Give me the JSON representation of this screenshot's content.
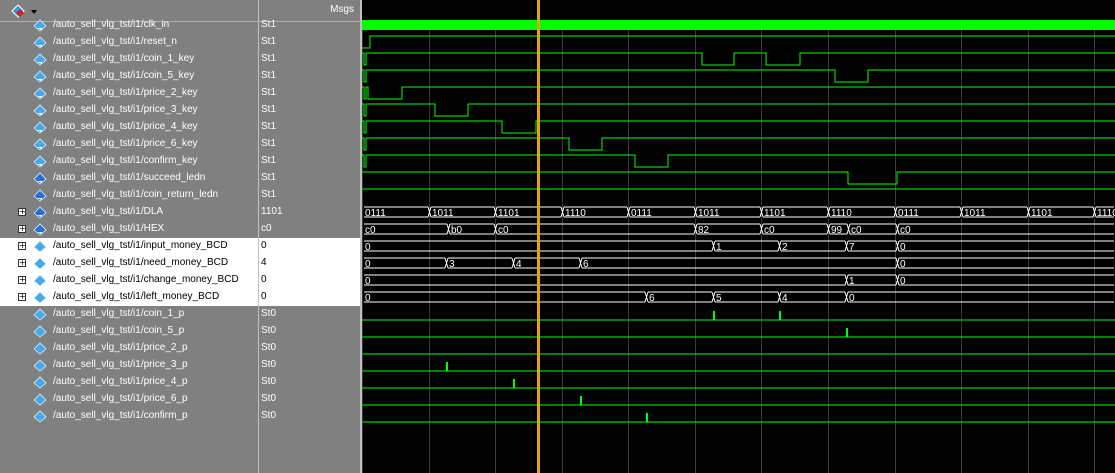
{
  "header": {
    "msgs_label": "Msgs"
  },
  "signals": [
    {
      "name": "/auto_sell_vlg_tst/i1/clk_in",
      "value": "St1",
      "kind": "in",
      "bus": false
    },
    {
      "name": "/auto_sell_vlg_tst/i1/reset_n",
      "value": "St1",
      "kind": "in",
      "bus": false
    },
    {
      "name": "/auto_sell_vlg_tst/i1/coin_1_key",
      "value": "St1",
      "kind": "in",
      "bus": false
    },
    {
      "name": "/auto_sell_vlg_tst/i1/coin_5_key",
      "value": "St1",
      "kind": "in",
      "bus": false
    },
    {
      "name": "/auto_sell_vlg_tst/i1/price_2_key",
      "value": "St1",
      "kind": "in",
      "bus": false
    },
    {
      "name": "/auto_sell_vlg_tst/i1/price_3_key",
      "value": "St1",
      "kind": "in",
      "bus": false
    },
    {
      "name": "/auto_sell_vlg_tst/i1/price_4_key",
      "value": "St1",
      "kind": "in",
      "bus": false
    },
    {
      "name": "/auto_sell_vlg_tst/i1/price_6_key",
      "value": "St1",
      "kind": "in",
      "bus": false
    },
    {
      "name": "/auto_sell_vlg_tst/i1/confirm_key",
      "value": "St1",
      "kind": "in",
      "bus": false
    },
    {
      "name": "/auto_sell_vlg_tst/i1/succeed_ledn",
      "value": "St1",
      "kind": "out",
      "bus": false
    },
    {
      "name": "/auto_sell_vlg_tst/i1/coin_return_ledn",
      "value": "St1",
      "kind": "out",
      "bus": false
    },
    {
      "name": "/auto_sell_vlg_tst/i1/DLA",
      "value": "1101",
      "kind": "out",
      "bus": true
    },
    {
      "name": "/auto_sell_vlg_tst/i1/HEX",
      "value": "c0",
      "kind": "out",
      "bus": true
    },
    {
      "name": "/auto_sell_vlg_tst/i1/input_money_BCD",
      "value": "0",
      "kind": "int",
      "bus": true,
      "selected": true
    },
    {
      "name": "/auto_sell_vlg_tst/i1/need_money_BCD",
      "value": "4",
      "kind": "int",
      "bus": true,
      "selected": true
    },
    {
      "name": "/auto_sell_vlg_tst/i1/change_money_BCD",
      "value": "0",
      "kind": "int",
      "bus": true,
      "selected": true
    },
    {
      "name": "/auto_sell_vlg_tst/i1/left_money_BCD",
      "value": "0",
      "kind": "int",
      "bus": true,
      "selected": true
    },
    {
      "name": "/auto_sell_vlg_tst/i1/coin_1_p",
      "value": "St0",
      "kind": "int",
      "bus": false
    },
    {
      "name": "/auto_sell_vlg_tst/i1/coin_5_p",
      "value": "St0",
      "kind": "int",
      "bus": false
    },
    {
      "name": "/auto_sell_vlg_tst/i1/price_2_p",
      "value": "St0",
      "kind": "int",
      "bus": false
    },
    {
      "name": "/auto_sell_vlg_tst/i1/price_3_p",
      "value": "St0",
      "kind": "int",
      "bus": false
    },
    {
      "name": "/auto_sell_vlg_tst/i1/price_4_p",
      "value": "St0",
      "kind": "int",
      "bus": false
    },
    {
      "name": "/auto_sell_vlg_tst/i1/price_6_p",
      "value": "St0",
      "kind": "int",
      "bus": false
    },
    {
      "name": "/auto_sell_vlg_tst/i1/confirm_p",
      "value": "St0",
      "kind": "int",
      "bus": false
    }
  ],
  "waves": {
    "dla_labels": [
      "0111",
      "1011",
      "1101",
      "1110",
      "0111",
      "1011",
      "1101",
      "1110",
      "0111",
      "1011",
      "1101",
      "1110"
    ],
    "hex_labels": [
      "c0",
      "b0",
      "c0",
      "82",
      "c0",
      "99",
      "c0",
      "c0"
    ],
    "input_money_labels": [
      "0",
      "1",
      "2",
      "7",
      "0"
    ],
    "need_money_labels": [
      "0",
      "3",
      "4",
      "6",
      "0"
    ],
    "change_money_labels": [
      "0",
      "1",
      "0"
    ],
    "left_money_labels": [
      "0",
      "6",
      "5",
      "4",
      "0"
    ]
  },
  "colors": {
    "wave": "#00ff00",
    "cursor": "#e8a400",
    "bg": "#000000",
    "panel": "#808080"
  }
}
